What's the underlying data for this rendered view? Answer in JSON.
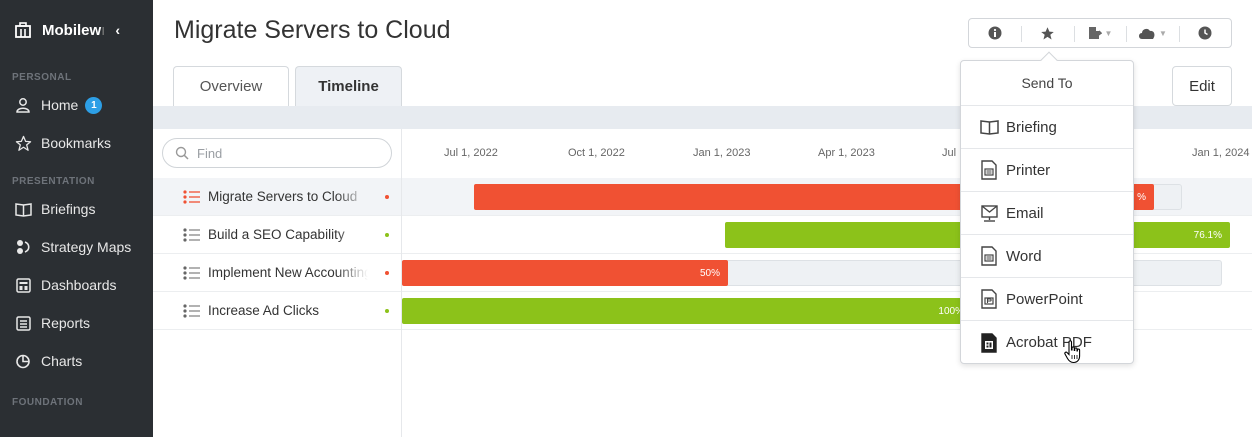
{
  "sidebar": {
    "app_name": "Mobilew",
    "app_name_fade": "ı",
    "collapse_glyph": "‹",
    "sections": {
      "personal": "PERSONAL",
      "presentation": "PRESENTATION",
      "foundation": "FOUNDATION"
    },
    "home": {
      "label": "Home",
      "badge": "1"
    },
    "bookmarks": {
      "label": "Bookmarks"
    },
    "briefings": {
      "label": "Briefings"
    },
    "strategy_maps": {
      "label": "Strategy Maps"
    },
    "dashboards": {
      "label": "Dashboards"
    },
    "reports": {
      "label": "Reports"
    },
    "charts": {
      "label": "Charts"
    }
  },
  "header": {
    "title": "Migrate Servers to Cloud",
    "edit_label": "Edit"
  },
  "tabs": [
    {
      "label": "Overview"
    },
    {
      "label": "Timeline"
    }
  ],
  "search": {
    "placeholder": "Find"
  },
  "timeline": {
    "dates": [
      "Jul 1, 2022",
      "Oct 1, 2022",
      "Jan 1, 2023",
      "Apr 1, 2023",
      "Jul",
      "Jan 1, 2024"
    ],
    "tasks": [
      {
        "name": "Migrate Servers to Cloud",
        "status_color": "#f05133",
        "bar_color": "#f05133",
        "progress_label": "%"
      },
      {
        "name": "Build a SEO Capability",
        "status_color": "#8cc21a",
        "bar_color": "#8cc21a",
        "progress_label": "76.1%"
      },
      {
        "name": "Implement New Accounting",
        "status_color": "#f05133",
        "bar_color": "#f05133",
        "progress_label": "50%"
      },
      {
        "name": "Increase Ad Clicks",
        "status_color": "#8cc21a",
        "bar_color": "#8cc21a",
        "progress_label": "100%"
      }
    ]
  },
  "send_to": {
    "title": "Send To",
    "items": [
      {
        "label": "Briefing",
        "icon": "book-icon"
      },
      {
        "label": "Printer",
        "icon": "printer-file-icon"
      },
      {
        "label": "Email",
        "icon": "email-icon"
      },
      {
        "label": "Word",
        "icon": "word-file-icon"
      },
      {
        "label": "PowerPoint",
        "icon": "powerpoint-file-icon"
      },
      {
        "label": "Acrobat PDF",
        "icon": "pdf-file-icon"
      }
    ]
  },
  "toolbar": {
    "icons": [
      "info-icon",
      "star-icon",
      "export-icon",
      "cloud-icon",
      "clock-icon"
    ]
  }
}
